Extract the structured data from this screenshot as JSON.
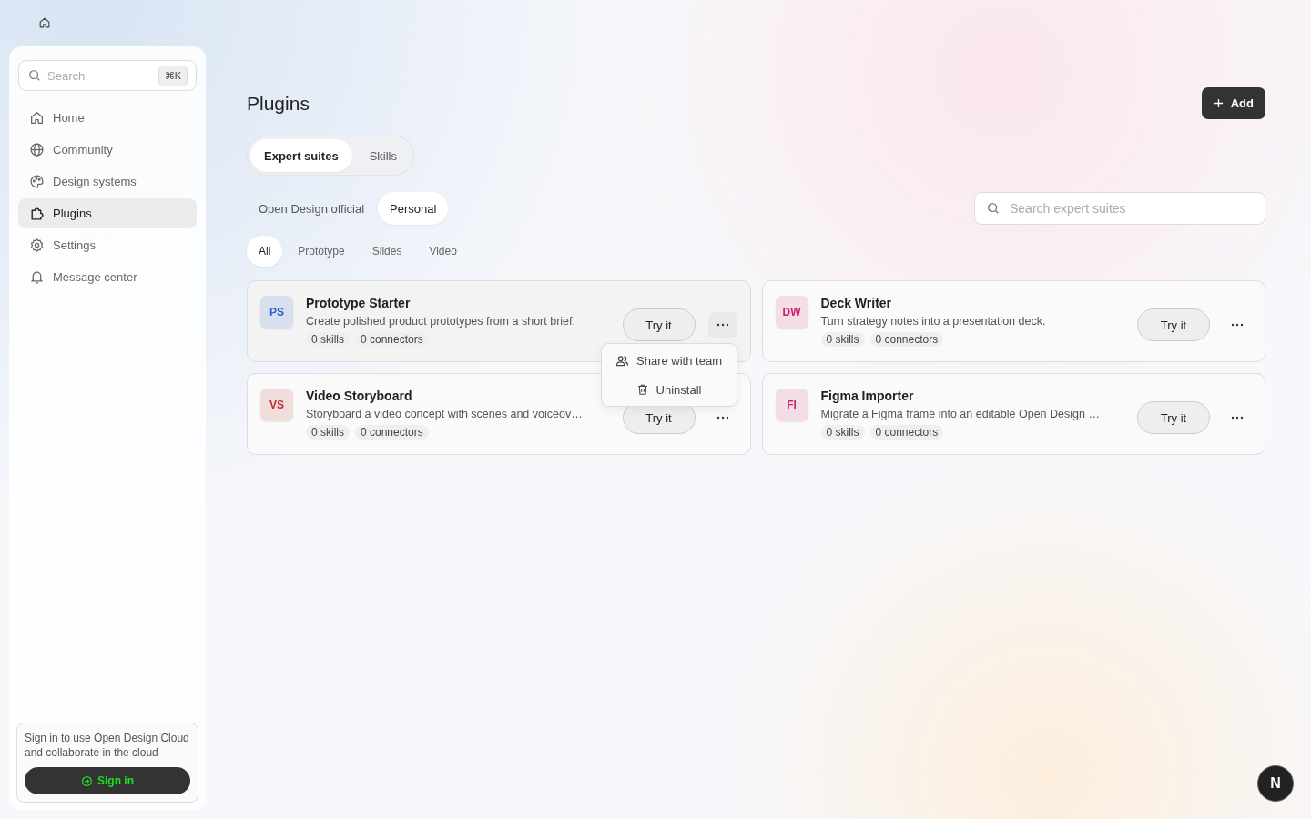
{
  "sidebar": {
    "search": {
      "placeholder": "Search",
      "shortcut": "⌘K"
    },
    "items": [
      {
        "label": "Home",
        "selected": false
      },
      {
        "label": "Community",
        "selected": false
      },
      {
        "label": "Design systems",
        "selected": false
      },
      {
        "label": "Plugins",
        "selected": true
      },
      {
        "label": "Settings",
        "selected": false
      },
      {
        "label": "Message center",
        "selected": false
      }
    ],
    "signin": {
      "text": "Sign in to use Open Design Cloud and collaborate in the cloud",
      "button": "Sign in"
    }
  },
  "page": {
    "title": "Plugins",
    "add_button": "Add"
  },
  "tabs": [
    {
      "label": "Expert suites",
      "selected": true
    },
    {
      "label": "Skills",
      "selected": false
    }
  ],
  "sources": [
    {
      "label": "Open Design official",
      "selected": false
    },
    {
      "label": "Personal",
      "selected": true
    }
  ],
  "search": {
    "placeholder": "Search expert suites"
  },
  "filters": [
    {
      "label": "All",
      "selected": true
    },
    {
      "label": "Prototype",
      "selected": false
    },
    {
      "label": "Slides",
      "selected": false
    },
    {
      "label": "Video",
      "selected": false
    }
  ],
  "plugins": [
    {
      "initials": "PS",
      "color": "#2f5fd0",
      "name": "Prototype Starter",
      "description": "Create polished product prototypes from a short brief.",
      "skills": "0 skills",
      "connectors": "0 connectors",
      "button": "Try it",
      "menu_open": true,
      "menu": [
        {
          "label": "Share with team"
        },
        {
          "label": "Uninstall"
        }
      ]
    },
    {
      "initials": "DW",
      "color": "#c8246e",
      "name": "Deck Writer",
      "description": "Turn strategy notes into a presentation deck.",
      "skills": "0 skills",
      "connectors": "0 connectors",
      "button": "Try it",
      "menu_open": false
    },
    {
      "initials": "VS",
      "color": "#c62828",
      "name": "Video Storyboard",
      "description": "Storyboard a video concept with scenes and voiceov…",
      "skills": "0 skills",
      "connectors": "0 connectors",
      "button": "Try it",
      "menu_open": false
    },
    {
      "initials": "FI",
      "color": "#c8246e",
      "name": "Figma Importer",
      "description": "Migrate a Figma frame into an editable Open Design …",
      "skills": "0 skills",
      "connectors": "0 connectors",
      "button": "Try it",
      "menu_open": false
    }
  ],
  "assistant_badge": "N"
}
